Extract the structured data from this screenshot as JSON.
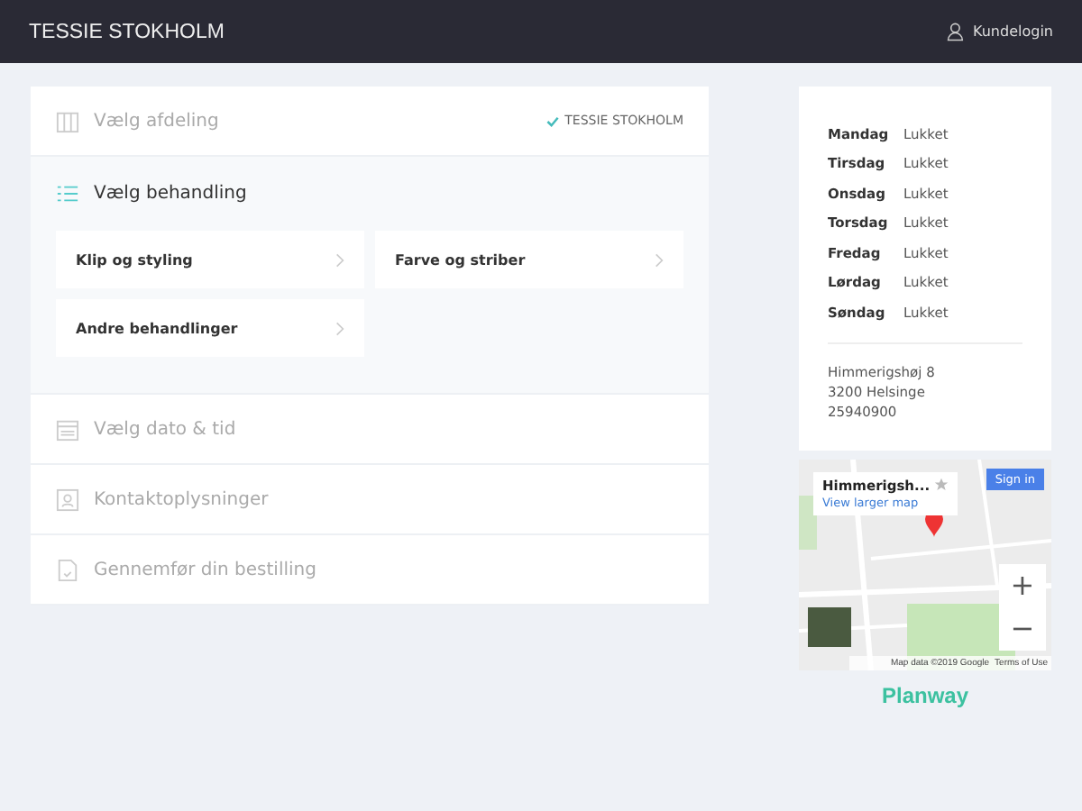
{
  "header": {
    "title": "TESSIE STOKHOLM",
    "login": "Kundelogin"
  },
  "steps": [
    {
      "kind": "department",
      "label": "Vælg afdeling",
      "expanded": false,
      "value": "TESSIE STOKHOLM"
    },
    {
      "kind": "treatment",
      "label": "Vælg behandling",
      "expanded": true,
      "options": [
        "Klip og styling",
        "Farve og striber",
        "Andre behandlinger"
      ]
    },
    {
      "kind": "date",
      "label": "Vælg dato & tid",
      "expanded": false
    },
    {
      "kind": "contact",
      "label": "Kontaktoplysninger",
      "expanded": false
    },
    {
      "kind": "confirm",
      "label": "Gennemfør din bestilling",
      "expanded": false
    }
  ],
  "hours": [
    {
      "day": "Mandag",
      "time": "Lukket"
    },
    {
      "day": "Tirsdag",
      "time": "Lukket"
    },
    {
      "day": "Onsdag",
      "time": "Lukket"
    },
    {
      "day": "Torsdag",
      "time": "Lukket"
    },
    {
      "day": "Fredag",
      "time": "Lukket"
    },
    {
      "day": "Lørdag",
      "time": "Lukket"
    },
    {
      "day": "Søndag",
      "time": "Lukket"
    }
  ],
  "address": [
    "Himmerigshøj 8",
    "3200 Helsinge",
    "25940900"
  ],
  "map": {
    "place": "Himmerigsh...",
    "link": "View larger map",
    "sign_in": "Sign in",
    "zoom_in": "+",
    "zoom_out": "−",
    "attribution": "Map data ©2019 Google",
    "terms": "Terms of Use"
  },
  "brand": "Planway"
}
